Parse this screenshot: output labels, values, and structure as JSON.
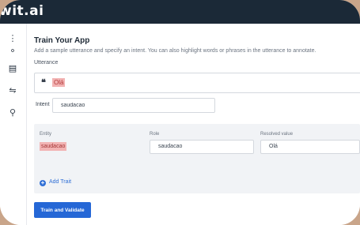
{
  "app": {
    "brand": "wit.ai"
  },
  "sidebar": {
    "items": [
      {
        "icon": "dots-icon",
        "glyph": "⋮"
      },
      {
        "icon": "workflow-icon",
        "glyph": "⚬"
      },
      {
        "icon": "database-icon",
        "glyph": "▤"
      },
      {
        "icon": "sliders-icon",
        "glyph": "⇋"
      },
      {
        "icon": "graph-icon",
        "glyph": "⚲"
      }
    ]
  },
  "page": {
    "title": "Train Your App",
    "subtitle": "Add a sample utterance and specify an intent. You can also highlight words or phrases in the utterance to annotate."
  },
  "utterance": {
    "label": "Utterance",
    "quote": "❝",
    "text": "Olá",
    "highlight_color": "#f2b3b3"
  },
  "intent": {
    "label": "Intent",
    "value": "saudacao"
  },
  "entities": {
    "headers": {
      "entity": "Entity",
      "role": "Role",
      "resolved": "Resolved value"
    },
    "row": {
      "entity": "saudacao",
      "role": "saudacao",
      "resolved": "Olá"
    }
  },
  "add_trait": {
    "label": "Add Trait"
  },
  "actions": {
    "train_label": "Train and Validate"
  },
  "colors": {
    "accent": "#2567d6",
    "topbar": "#1b2937",
    "highlight": "#f2b3b3"
  }
}
